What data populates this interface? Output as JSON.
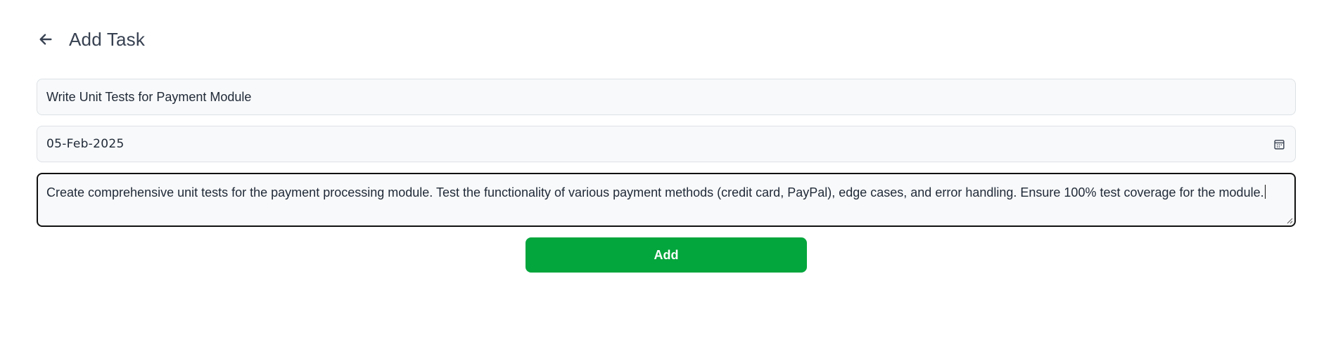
{
  "header": {
    "back_icon": "arrow-left-icon",
    "title": "Add Task"
  },
  "form": {
    "task_title": "Write Unit Tests for Payment Module",
    "due_date": "05-Feb-2025",
    "calendar_icon": "calendar-icon",
    "description": "Create comprehensive unit tests for the payment processing module. Test the functionality of various payment methods (credit card, PayPal), edge cases, and error handling. Ensure 100% test coverage for the module.",
    "submit_label": "Add"
  },
  "colors": {
    "primary": "#03a63c",
    "field_bg": "#f8f9fa",
    "field_border": "#dde1e5",
    "focus_border": "#111111"
  }
}
